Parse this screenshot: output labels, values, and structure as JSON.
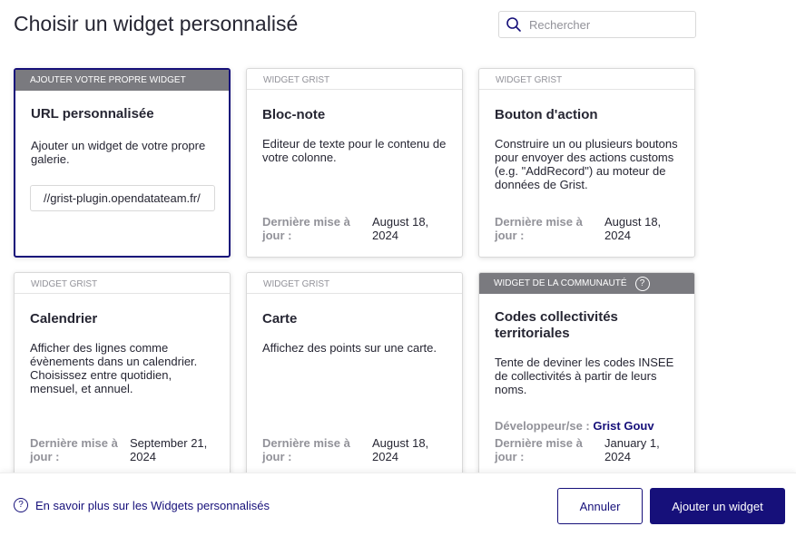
{
  "header": {
    "title": "Choisir un widget personnalisé",
    "search_placeholder": "Rechercher"
  },
  "cards": [
    {
      "type": "AJOUTER VOTRE PROPRE WIDGET",
      "name": "URL personnalisée",
      "description": "Ajouter un widget de votre propre galerie.",
      "url_value": "//grist-plugin.opendatateam.fr/"
    },
    {
      "type": "WIDGET GRIST",
      "name": "Bloc-note",
      "description": "Editeur de texte pour le contenu de votre colonne.",
      "updated_label": "Dernière mise à jour :",
      "updated_value": "August 18, 2024"
    },
    {
      "type": "WIDGET GRIST",
      "name": "Bouton d'action",
      "description": "Construire un ou plusieurs boutons pour envoyer des actions customs (e.g. \"AddRecord\") au moteur de données de Grist.",
      "updated_label": "Dernière mise à jour :",
      "updated_value": "August 18, 2024"
    },
    {
      "type": "WIDGET GRIST",
      "name": "Calendrier",
      "description": "Afficher des lignes comme évènements dans un calendrier. Choisissez entre quotidien, mensuel, et annuel.",
      "updated_label": "Dernière mise à jour :",
      "updated_value": "September 21, 2024"
    },
    {
      "type": "WIDGET GRIST",
      "name": "Carte",
      "description": "Affichez des points sur une carte.",
      "updated_label": "Dernière mise à jour :",
      "updated_value": "August 18, 2024"
    },
    {
      "type": "WIDGET DE LA COMMUNAUTÉ",
      "name": "Codes collectivités territoriales",
      "description": "Tente de deviner les codes INSEE de collectivités à partir de leurs noms.",
      "developer_label": "Développeur/se :",
      "developer_value": "Grist Gouv",
      "updated_label": "Dernière mise à jour :",
      "updated_value": "January 1, 2024"
    }
  ],
  "footer": {
    "learn_more": "En savoir plus sur les Widgets personnalisés",
    "cancel": "Annuler",
    "add": "Ajouter un widget"
  },
  "colors": {
    "accent": "#16107a",
    "muted": "#929299",
    "badge_bg": "#7a7a7f"
  },
  "icons": {
    "search": "search-icon",
    "help": "question-circle-icon"
  }
}
